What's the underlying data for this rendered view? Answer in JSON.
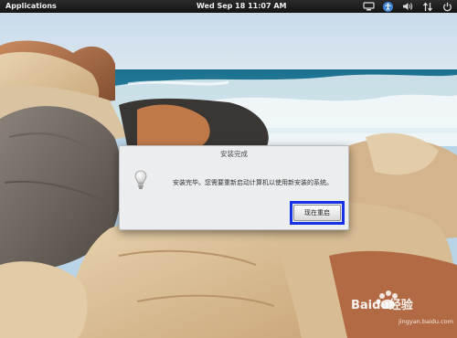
{
  "panel": {
    "apps_label": "Applications",
    "clock": "Wed Sep 18  11:07 AM",
    "tray_icons": [
      "monitor-icon",
      "accessibility-icon",
      "volume-icon",
      "network-arrows-icon",
      "power-icon"
    ]
  },
  "dialog": {
    "title": "安装完成",
    "icon": "lightbulb-icon",
    "message": "安装完毕。您需要重新启动计算机以使用新安装的系统。",
    "restart_button": "现在重启"
  },
  "highlight_color": "#1632e6",
  "wallpaper": "rocks-and-sea",
  "watermark": {
    "text": "Baidu经验",
    "url": "jingyan.baidu.com"
  }
}
